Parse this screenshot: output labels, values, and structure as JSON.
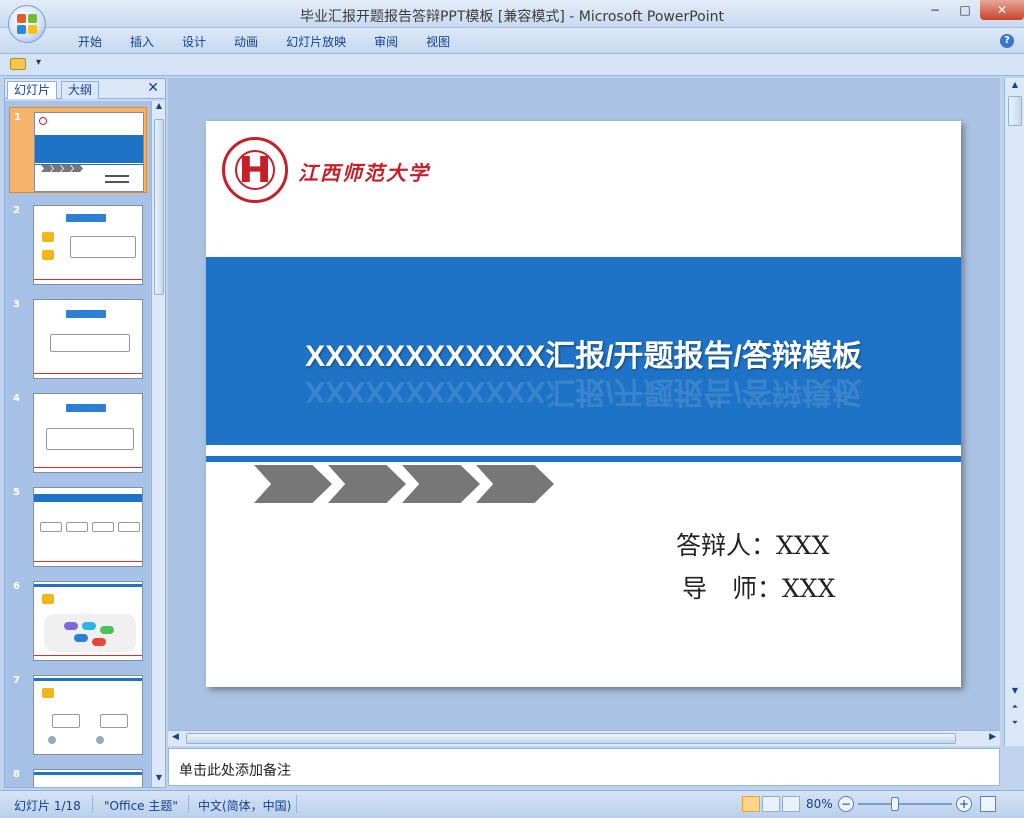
{
  "window": {
    "title": "毕业汇报开题报告答辩PPT模板 [兼容模式] - Microsoft PowerPoint",
    "minimize": "−",
    "maximize": "□",
    "close": "✕"
  },
  "ribbon": {
    "tabs": [
      "开始",
      "插入",
      "设计",
      "动画",
      "幻灯片放映",
      "审阅",
      "视图"
    ],
    "help": "?"
  },
  "qat": {
    "dropdown": "▾"
  },
  "panel": {
    "tabs": [
      "幻灯片",
      "大纲"
    ],
    "close": "✕",
    "slide_numbers": [
      "1",
      "2",
      "3",
      "4",
      "5",
      "6",
      "7",
      "8"
    ]
  },
  "slide": {
    "university": "江西师范大学",
    "title": "XXXXXXXXXXXX汇报/开题报告/答辩模板",
    "defender": "答辩人：XXX",
    "advisor": "导　师：XXX"
  },
  "notes": {
    "placeholder": "单击此处添加备注"
  },
  "status": {
    "slide_counter": "幻灯片 1/18",
    "theme": "\"Office 主题\"",
    "language": "中文(简体，中国)",
    "zoom": "80%",
    "zoom_minus": "−",
    "zoom_plus": "+"
  },
  "colors": {
    "accent_blue": "#1e73c6",
    "brand_red": "#c3202a",
    "chevron_gray": "#777777"
  }
}
